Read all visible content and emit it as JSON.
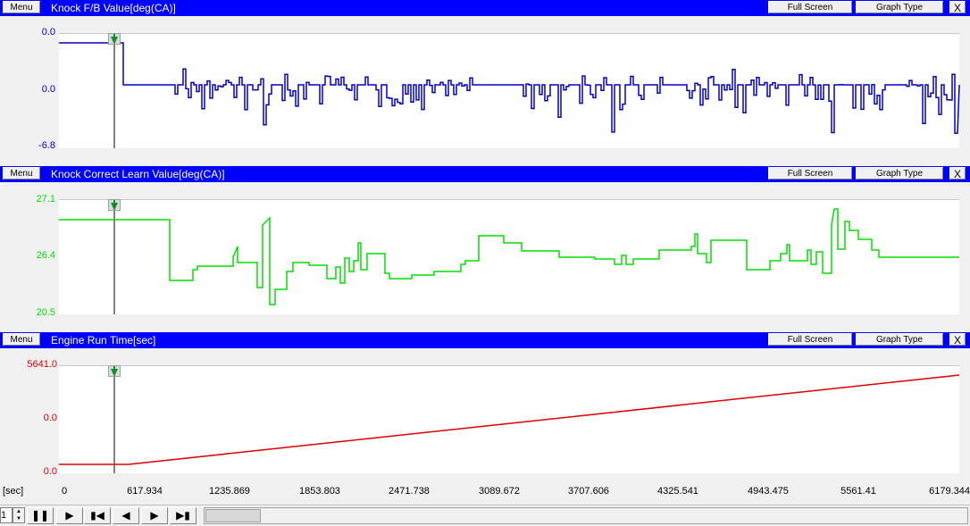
{
  "panels": [
    {
      "menu": "Menu",
      "title": "Knock F/B Value[deg(CA)]",
      "full_screen": "Full Screen",
      "graph_type": "Graph Type",
      "close": "X",
      "y_labels": [
        "0.0",
        "0.0",
        "-6.8"
      ],
      "color": "#0000cc"
    },
    {
      "menu": "Menu",
      "title": "Knock Correct Learn Value[deg(CA)]",
      "full_screen": "Full Screen",
      "graph_type": "Graph Type",
      "close": "X",
      "y_labels": [
        "27.1",
        "26.4",
        "20.5"
      ],
      "color": "#00e000"
    },
    {
      "menu": "Menu",
      "title": "Engine Run Time[sec]",
      "full_screen": "Full Screen",
      "graph_type": "Graph Type",
      "close": "X",
      "y_labels": [
        "5641.0",
        "0.0",
        "0.0"
      ],
      "color": "#dd0000"
    }
  ],
  "x_axis": {
    "unit": "[sec]",
    "ticks": [
      "0",
      "617.934",
      "1235.869",
      "1853.803",
      "2471.738",
      "3089.672",
      "3707.606",
      "4325.541",
      "4943.475",
      "5561.41",
      "6179.344"
    ]
  },
  "toolbar": {
    "speed": "1",
    "pause": "❚❚",
    "play": "▶",
    "step_back": "▮◀",
    "back": "◀",
    "forward": "▶",
    "step_forward": "▶▮"
  },
  "icons": {
    "marker": "cursor-marker-icon"
  }
}
